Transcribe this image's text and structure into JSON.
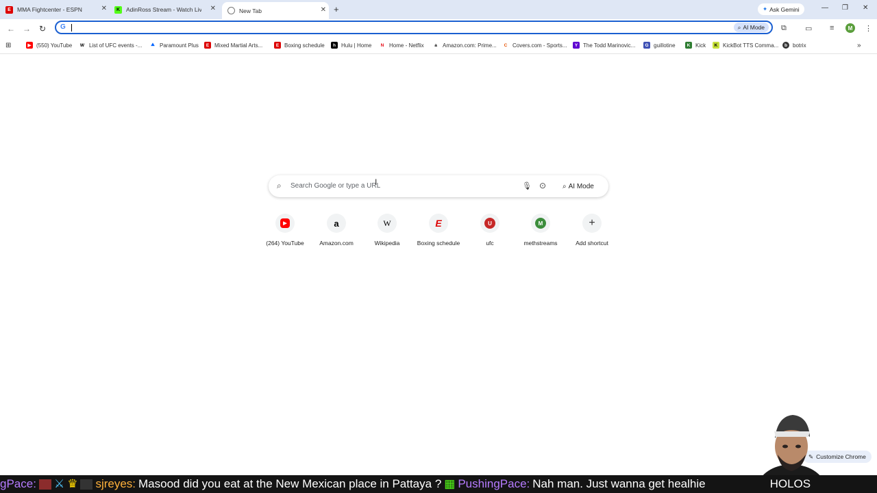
{
  "tabs": [
    {
      "title": "MMA Fightcenter - ESPN",
      "favicon": "espn-icon",
      "color": "#d00"
    },
    {
      "title": "AdinRoss Stream - Watch Live o",
      "favicon": "kick-icon",
      "color": "#53fc18"
    },
    {
      "title": "New Tab",
      "favicon": "chrome-icon",
      "active": true
    }
  ],
  "toolbar": {
    "ask_gemini": "Ask Gemini",
    "omnibox_value": "",
    "ai_mode": "AI Mode",
    "profile_initial": "M"
  },
  "bookmarks": [
    {
      "label": "(550) YouTube",
      "icon": "youtube-icon"
    },
    {
      "label": "List of UFC events -...",
      "icon": "wikipedia-icon"
    },
    {
      "label": "Paramount Plus",
      "icon": "paramount-icon"
    },
    {
      "label": "Mixed Martial Arts...",
      "icon": "espn-icon"
    },
    {
      "label": "Boxing schedule",
      "icon": "espn-icon"
    },
    {
      "label": "Hulu | Home",
      "icon": "hulu-icon"
    },
    {
      "label": "Home - Netflix",
      "icon": "netflix-icon"
    },
    {
      "label": "Amazon.com: Prime...",
      "icon": "amazon-icon"
    },
    {
      "label": "Covers.com - Sports...",
      "icon": "covers-icon"
    },
    {
      "label": "The Todd Marinovic...",
      "icon": "yahoo-icon"
    },
    {
      "label": "guillotine",
      "icon": "guillotine-icon"
    },
    {
      "label": "Kick",
      "icon": "kick-icon"
    },
    {
      "label": "KickBot TTS Comma...",
      "icon": "kickbot-icon"
    },
    {
      "label": "botrix",
      "icon": "botrix-icon"
    }
  ],
  "search": {
    "placeholder": "Search Google or type a URL",
    "ai_mode": "AI Mode"
  },
  "shortcuts": [
    {
      "label": "(264) YouTube",
      "icon": "youtube-icon",
      "letter": "▶",
      "color": "#f00"
    },
    {
      "label": "Amazon.com",
      "icon": "amazon-icon",
      "letter": "a",
      "color": "#000"
    },
    {
      "label": "Wikipedia",
      "icon": "wikipedia-icon",
      "letter": "W",
      "color": "#000"
    },
    {
      "label": "Boxing schedule",
      "icon": "espn-icon",
      "letter": "E",
      "color": "#d00"
    },
    {
      "label": "ufc",
      "icon": "ufc-icon",
      "letter": "U",
      "color": "#c62828"
    },
    {
      "label": "methstreams",
      "icon": "methstreams-icon",
      "letter": "M",
      "color": "#3c8d3c"
    },
    {
      "label": "Add shortcut",
      "icon": "plus-icon",
      "letter": "+",
      "color": "#333"
    }
  ],
  "customize": "Customize Chrome",
  "chat_ticker": {
    "u0": "gPace:",
    "u1": "sjreyes:",
    "m1": "Masood did you eat at the New Mexican place in Pattaya ?",
    "u2": "PushingPace:",
    "m2": "Nah man. Just wanna get healhie",
    "tail": "HOLOS"
  }
}
